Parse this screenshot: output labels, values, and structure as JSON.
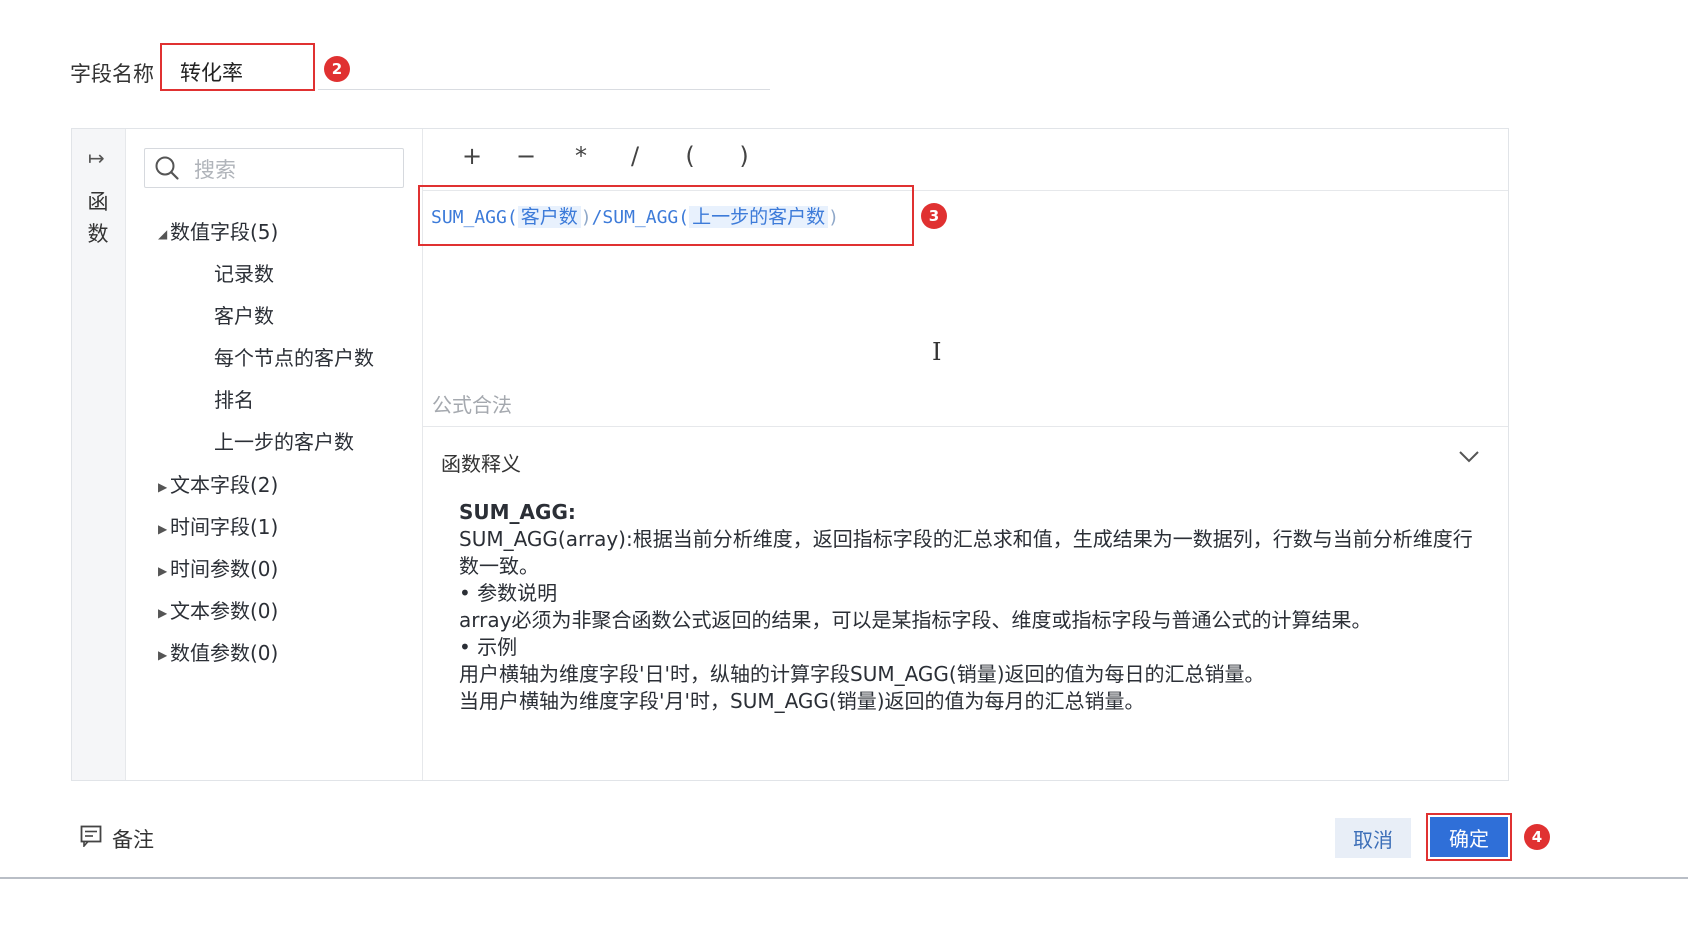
{
  "field": {
    "label": "字段名称",
    "value": "转化率",
    "badge": "2"
  },
  "side": {
    "label": "函数"
  },
  "search": {
    "placeholder": "搜索"
  },
  "tree": {
    "groups": [
      {
        "label": "数值字段(5)",
        "expanded": true,
        "items": [
          "记录数",
          "客户数",
          "每个节点的客户数",
          "排名",
          "上一步的客户数"
        ]
      },
      {
        "label": "文本字段(2)",
        "expanded": false
      },
      {
        "label": "时间字段(1)",
        "expanded": false
      },
      {
        "label": "时间参数(0)",
        "expanded": false
      },
      {
        "label": "文本参数(0)",
        "expanded": false
      },
      {
        "label": "数值参数(0)",
        "expanded": false
      }
    ]
  },
  "operators": [
    "+",
    "−",
    "*",
    "/",
    "(",
    ")"
  ],
  "formula": {
    "func1": "SUM_AGG(",
    "arg1": "客户数",
    "close1": ")",
    "slash": "/",
    "func2": "SUM_AGG(",
    "arg2": "上一步的客户数",
    "close2": ")",
    "badge": "3"
  },
  "validation": "公式合法",
  "definition": {
    "title": "函数释义",
    "name": "SUM_AGG:",
    "lines": [
      "SUM_AGG(array):根据当前分析维度，返回指标字段的汇总求和值，生成结果为一数据列，行数与当前分析维度行数一致。",
      "• 参数说明",
      "array必须为非聚合函数公式返回的结果，可以是某指标字段、维度或指标字段与普通公式的计算结果。",
      "• 示例",
      "用户横轴为维度字段'日'时，纵轴的计算字段SUM_AGG(销量)返回的值为每日的汇总销量。",
      "当用户横轴为维度字段'月'时，SUM_AGG(销量)返回的值为每月的汇总销量。"
    ]
  },
  "footer": {
    "note": "备注",
    "cancel": "取消",
    "ok": "确定",
    "badge": "4"
  },
  "colors": {
    "accent": "#2f6fd8",
    "highlight_red": "#e03131",
    "formula_blue": "#3d7bd9"
  }
}
